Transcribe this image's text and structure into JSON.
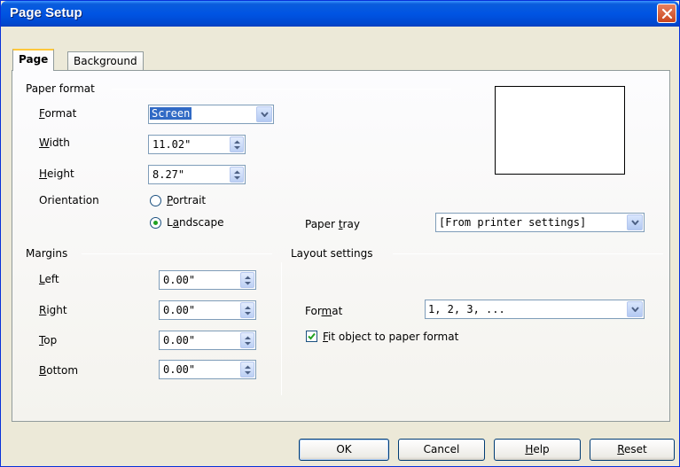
{
  "window": {
    "title": "Page Setup"
  },
  "tabs": [
    {
      "label": "Page"
    },
    {
      "label": "Background"
    }
  ],
  "paper_format": {
    "section_title": "Paper format",
    "format_label": "Format",
    "format_value": "Screen",
    "width_label": "Width",
    "width_value": "11.02\"",
    "height_label": "Height",
    "height_value": "8.27\"",
    "orientation_label": "Orientation",
    "portrait_label": "Portrait",
    "landscape_label": "Landscape",
    "orientation_selected": "Landscape",
    "paper_tray_label": "Paper tray",
    "paper_tray_value": "[From printer settings]"
  },
  "margins": {
    "section_title": "Margins",
    "left_label": "Left",
    "left_value": "0.00\"",
    "right_label": "Right",
    "right_value": "0.00\"",
    "top_label": "Top",
    "top_value": "0.00\"",
    "bottom_label": "Bottom",
    "bottom_value": "0.00\""
  },
  "layout_settings": {
    "section_title": "Layout settings",
    "format_label": "Format",
    "format_value": "1, 2, 3, ...",
    "fit_label": "Fit object to paper format",
    "fit_checked": true
  },
  "buttons": {
    "ok": "OK",
    "cancel": "Cancel",
    "help": "Help",
    "reset": "Reset"
  },
  "colors": {
    "title_bar": "#0054e3",
    "close_button": "#c9461f",
    "dialog_bg": "#ece9d8",
    "active_tab_accent": "#ffc83c"
  },
  "icons": {
    "close": "close-icon",
    "dropdown": "chevron-down-icon",
    "spin": "spin-arrows-icon",
    "check": "check-icon"
  }
}
